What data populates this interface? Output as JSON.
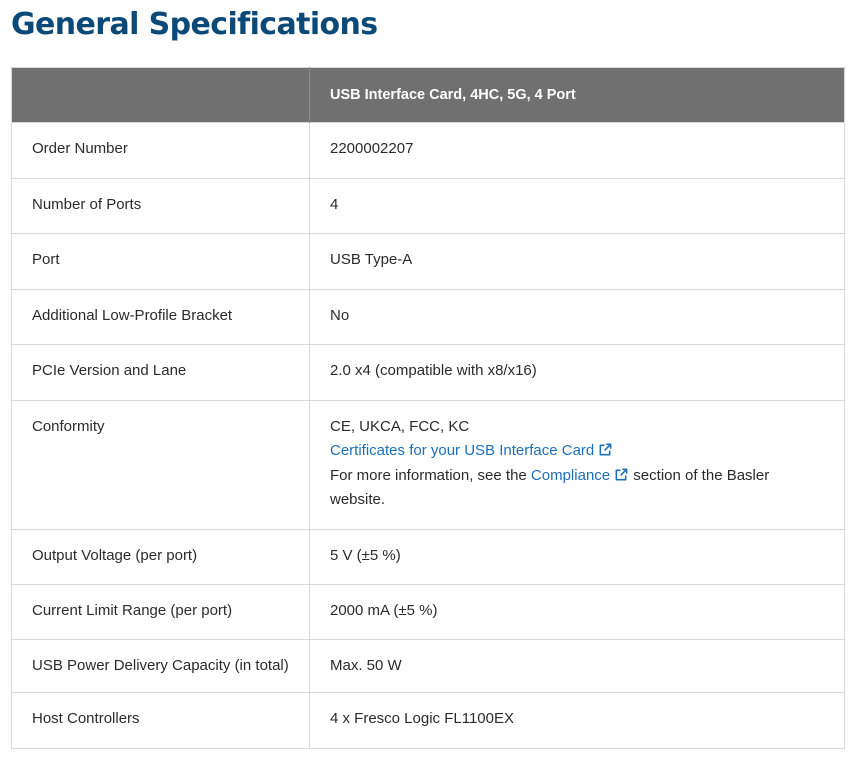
{
  "page": {
    "title": "General Specifications"
  },
  "table": {
    "header": {
      "blank": "",
      "product": "USB Interface Card, 4HC, 5G, 4 Port"
    },
    "rows": [
      {
        "label": "Order Number",
        "value": "2200002207"
      },
      {
        "label": "Number of Ports",
        "value": "4"
      },
      {
        "label": "Port",
        "value": "USB Type-A"
      },
      {
        "label": "Additional Low-Profile Bracket",
        "value": "No"
      },
      {
        "label": "PCIe Version and Lane",
        "value": "2.0 x4 (compatible with x8/x16)"
      },
      {
        "label": "Conformity",
        "value": "CE, UKCA, FCC, KC",
        "cert_link": "Certificates for your USB Interface Card",
        "info_prefix": "For more information, see the ",
        "compliance_link": "Compliance",
        "info_suffix": " section of the Basler website."
      },
      {
        "label": "Output Voltage (per port)",
        "value": "5 V (±5 %)"
      },
      {
        "label": "Current Limit Range (per port)",
        "value": "2000 mA (±5 %)"
      },
      {
        "label": "USB Power Delivery Capacity (in total)",
        "value": "Max. 50 W"
      },
      {
        "label": "Host Controllers",
        "value": "4 x Fresco Logic FL1100EX"
      }
    ]
  },
  "icons": {
    "external_link": "external-link-icon"
  },
  "colors": {
    "title": "#0b4a78",
    "header_bg": "#707070",
    "link": "#1d6fb8",
    "border": "#d9d9d9"
  }
}
